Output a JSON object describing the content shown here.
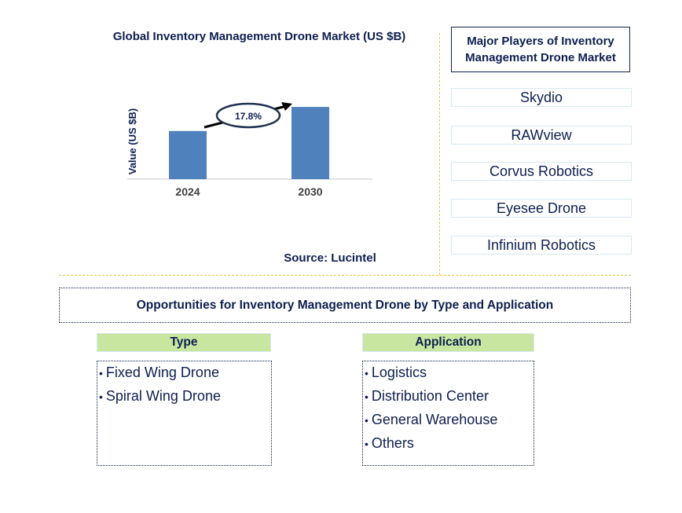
{
  "chart_data": {
    "type": "bar",
    "title": "Global Inventory Management Drone Market (US $B)",
    "xlabel": "",
    "ylabel": "Value (US $B)",
    "categories": [
      "2024",
      "2030"
    ],
    "values": [
      1.0,
      1.5
    ],
    "ylim": [
      0,
      1.6
    ],
    "grid": false,
    "annotations": [
      {
        "text": "17.8%",
        "type": "CAGR growth arrow from 2024 to 2030"
      }
    ],
    "bar_color": "#4f81bd",
    "source": "Source: Lucintel"
  },
  "players": {
    "header": "Major Players of Inventory Management Drone Market",
    "items": [
      "Skydio",
      "RAWview",
      "Corvus Robotics",
      "Eyesee Drone",
      "Infinium Robotics"
    ]
  },
  "opportunities": {
    "title": "Opportunities for Inventory Management Drone by Type and Application",
    "type": {
      "header": "Type",
      "items": [
        "Fixed Wing Drone",
        "Spiral Wing Drone"
      ]
    },
    "application": {
      "header": "Application",
      "items": [
        "Logistics",
        "Distribution Center",
        "General Warehouse",
        "Others"
      ]
    }
  },
  "colors": {
    "text": "#0d1f4f",
    "bar": "#4f81bd",
    "divider": "#f5c242",
    "category_header_bg": "#c8e6a0"
  }
}
